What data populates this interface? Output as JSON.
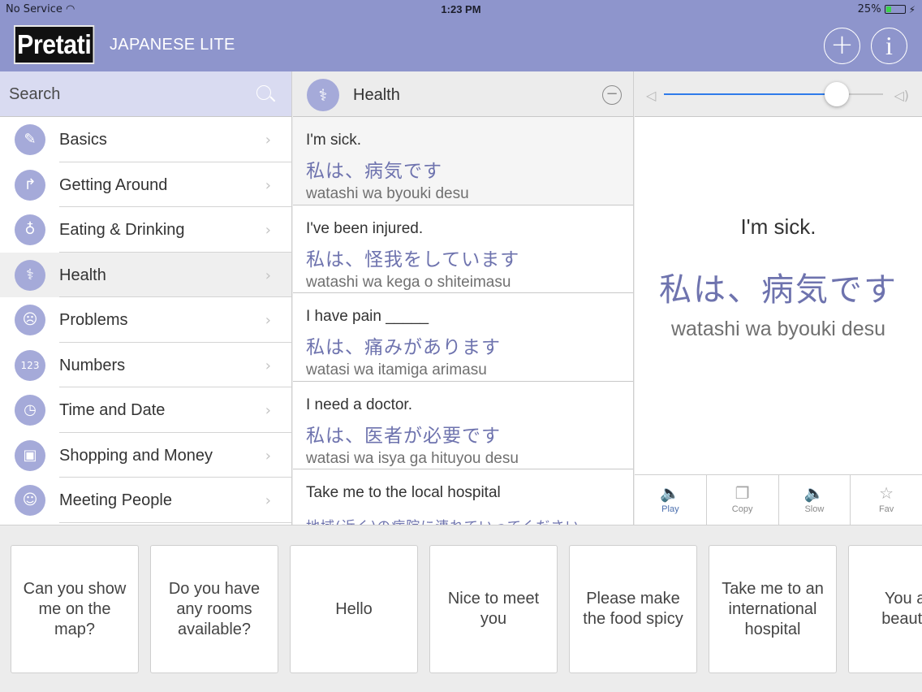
{
  "status": {
    "carrier": "No Service",
    "time": "1:23 PM",
    "battery": "25%"
  },
  "header": {
    "logo": "Pretati",
    "subtitle": "JAPANESE LITE",
    "add_symbol": "+",
    "info_symbol": "i"
  },
  "search": {
    "label": "Search"
  },
  "categories": [
    {
      "label": "Basics",
      "icon": "pencil-icon",
      "glyph": "✎"
    },
    {
      "label": "Getting Around",
      "icon": "turn-arrow-icon",
      "glyph": "↱"
    },
    {
      "label": "Eating & Drinking",
      "icon": "glass-icon",
      "glyph": "♁"
    },
    {
      "label": "Health",
      "icon": "stethoscope-icon",
      "glyph": "⚕"
    },
    {
      "label": "Problems",
      "icon": "sad-face-icon",
      "glyph": "☹"
    },
    {
      "label": "Numbers",
      "icon": "numbers-icon",
      "glyph": "123"
    },
    {
      "label": "Time and Date",
      "icon": "clock-icon",
      "glyph": "◷"
    },
    {
      "label": "Shopping and Money",
      "icon": "bag-icon",
      "glyph": "▣"
    },
    {
      "label": "Meeting People",
      "icon": "people-icon",
      "glyph": "☺"
    }
  ],
  "selected_category": "Health",
  "middle": {
    "title": "Health",
    "header_glyph": "⚕",
    "phrases": [
      {
        "en": "I'm sick.",
        "jp": "私は、病気です",
        "romaji": "watashi wa byouki desu"
      },
      {
        "en": "I've been injured.",
        "jp": "私は、怪我をしています",
        "romaji": "watashi wa kega o shiteimasu"
      },
      {
        "en": "I have pain _____",
        "jp": "私は、痛みがあります",
        "romaji": "watasi wa itamiga arimasu"
      },
      {
        "en": "I need a doctor.",
        "jp": "私は、医者が必要です",
        "romaji": "watasi wa isya ga hituyou desu"
      },
      {
        "en": "Take me to the local hospital",
        "jp": "地域(近く)の病院に連れていってください",
        "romaji": ""
      }
    ]
  },
  "detail": {
    "volume_fraction": 0.79,
    "en": "I'm sick.",
    "jp": "私は、病気です",
    "romaji": "watashi wa byouki desu",
    "actions": [
      {
        "label": "Play",
        "glyph": "🔈"
      },
      {
        "label": "Copy",
        "glyph": "❐"
      },
      {
        "label": "Slow",
        "glyph": "🔈"
      },
      {
        "label": "Fav",
        "glyph": "☆"
      }
    ]
  },
  "quick_cards": [
    "Can you show me on the map?",
    "Do you have any rooms available?",
    "Hello",
    "Nice to meet you",
    "Please make the food spicy",
    "Take me to an international hospital",
    "You are beautiful"
  ]
}
